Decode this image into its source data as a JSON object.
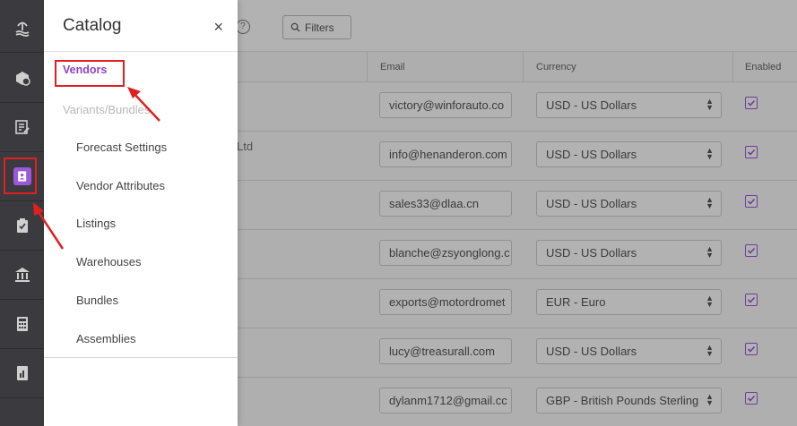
{
  "rail": {
    "items": [
      {
        "name": "rail-item-home",
        "icon": "beach-icon"
      },
      {
        "name": "rail-item-orders",
        "icon": "box-refresh-icon"
      },
      {
        "name": "rail-item-inventory",
        "icon": "sheet-edit-icon"
      },
      {
        "name": "rail-item-catalog",
        "icon": "contact-book-icon",
        "active": true
      },
      {
        "name": "rail-item-tasks",
        "icon": "clipboard-check-icon"
      },
      {
        "name": "rail-item-warehouse",
        "icon": "bank-icon"
      },
      {
        "name": "rail-item-calculator",
        "icon": "calculator-icon"
      },
      {
        "name": "rail-item-reports",
        "icon": "report-chart-icon"
      }
    ]
  },
  "topbar": {
    "filters_label": "Filters",
    "help_glyph": "?"
  },
  "table": {
    "headers": {
      "email": "Email",
      "currency": "Currency",
      "enabled": "Enabled"
    },
    "partial_vendor_text": "Ltd",
    "rows": [
      {
        "email": "victory@winforauto.co",
        "currency": "USD - US Dollars",
        "enabled": true
      },
      {
        "email": "info@henanderon.com",
        "currency": "USD - US Dollars",
        "enabled": true
      },
      {
        "email": "sales33@dlaa.cn",
        "currency": "USD - US Dollars",
        "enabled": true
      },
      {
        "email": "blanche@zsyonglong.c",
        "currency": "USD - US Dollars",
        "enabled": true
      },
      {
        "email": "exports@motordromet",
        "currency": "EUR - Euro",
        "enabled": true
      },
      {
        "email": "lucy@treasurall.com",
        "currency": "USD - US Dollars",
        "enabled": true
      },
      {
        "email": "dylanm1712@gmail.cc",
        "currency": "GBP - British Pounds Sterling",
        "enabled": true
      }
    ]
  },
  "catalog_panel": {
    "title": "Catalog",
    "close_glyph": "×",
    "items": {
      "vendors": "Vendors",
      "variants": "Variants/Bundles",
      "forecast": "Forecast Settings",
      "vendor_attributes": "Vendor Attributes",
      "listings": "Listings",
      "warehouses": "Warehouses",
      "bundles": "Bundles",
      "assemblies": "Assemblies"
    }
  },
  "colors": {
    "accent": "#9b59d9",
    "annotation": "#e02020",
    "rail": "#3b3b3f"
  }
}
